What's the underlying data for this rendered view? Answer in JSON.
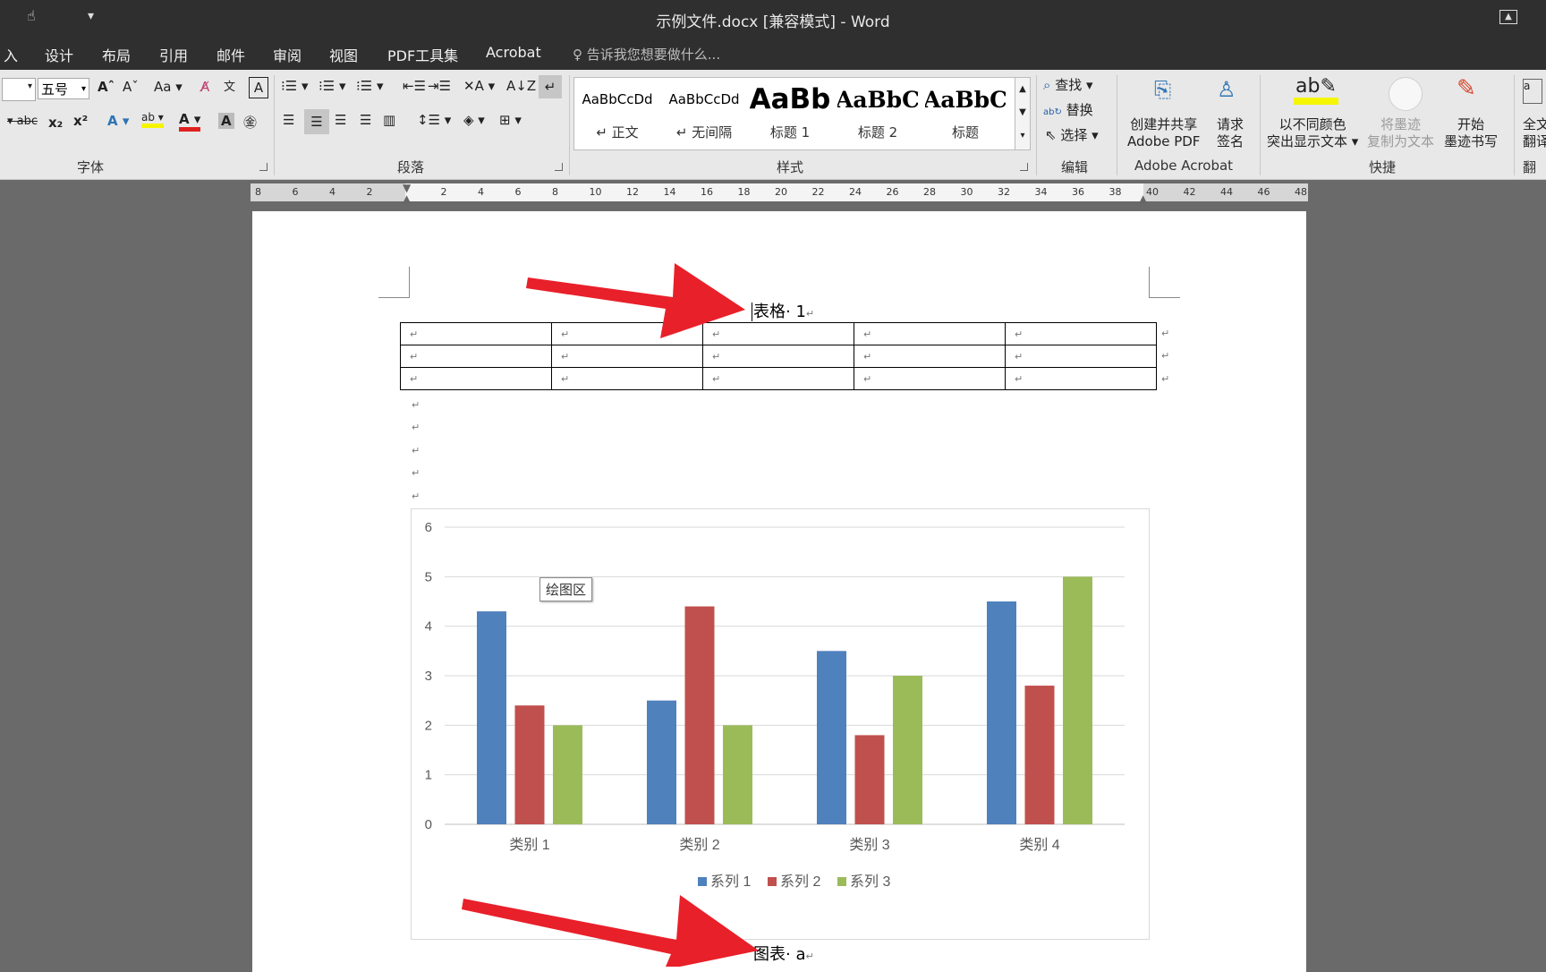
{
  "window": {
    "title": "示例文件.docx [兼容模式] - Word"
  },
  "tabs": [
    "入",
    "设计",
    "布局",
    "引用",
    "邮件",
    "审阅",
    "视图",
    "PDF工具集",
    "Acrobat"
  ],
  "tell_me": "告诉我您想要做什么...",
  "font_group": {
    "label": "字体",
    "size": "五号"
  },
  "paragraph_group": {
    "label": "段落"
  },
  "styles_group": {
    "label": "样式",
    "items": [
      {
        "sample": "AaBbCcDd",
        "name": "↵ 正文"
      },
      {
        "sample": "AaBbCcDd",
        "name": "↵ 无间隔"
      },
      {
        "sample": "AaBb",
        "name": "标题 1"
      },
      {
        "sample": "AaBbC",
        "name": "标题 2"
      },
      {
        "sample": "AaBbC",
        "name": "标题"
      }
    ]
  },
  "edit_group": {
    "label": "编辑",
    "find": "查找",
    "replace": "替换",
    "select": "选择"
  },
  "acrobat_group": {
    "label": "Adobe Acrobat",
    "create_line1": "创建并共享",
    "create_line2": "Adobe PDF",
    "sign_line1": "请求",
    "sign_line2": "签名"
  },
  "ink_group": {
    "label": "快捷",
    "highlight_line1": "以不同颜色",
    "highlight_line2": "突出显示文本",
    "convert_line1": "将墨迹",
    "convert_line2": "复制为文本",
    "start_line1": "开始",
    "start_line2": "墨迹书写"
  },
  "translate_group": {
    "label": "翻译",
    "line1": "全文",
    "line2": "翻译"
  },
  "ruler": [
    "8",
    "6",
    "4",
    "2",
    "",
    "2",
    "4",
    "6",
    "8",
    "10",
    "12",
    "14",
    "16",
    "18",
    "20",
    "22",
    "24",
    "26",
    "28",
    "30",
    "32",
    "34",
    "36",
    "38",
    "40",
    "42",
    "44",
    "46",
    "48"
  ],
  "document": {
    "table_caption": "表格· 1",
    "chart_caption": "图表· a",
    "paragraph_mark": "↵",
    "plot_area_tooltip": "绘图区"
  },
  "chart_data": {
    "type": "bar",
    "categories": [
      "类别 1",
      "类别 2",
      "类别 3",
      "类别 4"
    ],
    "series": [
      {
        "name": "系列 1",
        "values": [
          4.3,
          2.5,
          3.5,
          4.5
        ],
        "color": "#4f81bd"
      },
      {
        "name": "系列 2",
        "values": [
          2.4,
          4.4,
          1.8,
          2.8
        ],
        "color": "#c0504d"
      },
      {
        "name": "系列 3",
        "values": [
          2,
          2,
          3,
          5
        ],
        "color": "#9bbb59"
      }
    ],
    "ylim": [
      0,
      6
    ],
    "yticks": [
      "0",
      "1",
      "2",
      "3",
      "4",
      "5",
      "6"
    ],
    "grid": true,
    "legend_position": "bottom"
  },
  "colors": {
    "annotation_arrow": "#e8202a"
  }
}
